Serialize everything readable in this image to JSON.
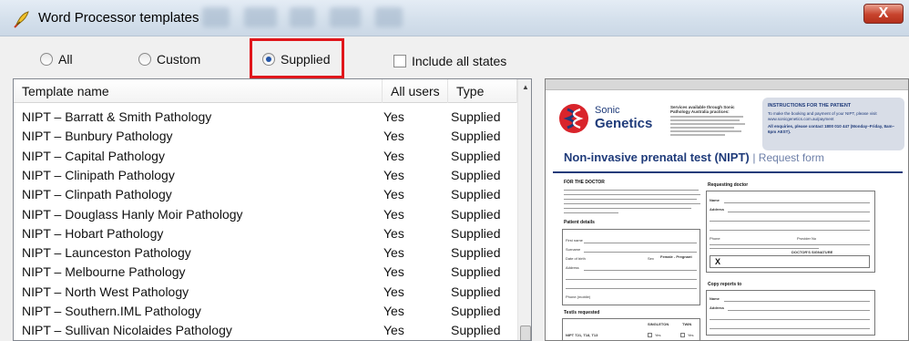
{
  "window": {
    "title": "Word Processor templates",
    "close_label": "X"
  },
  "filters": {
    "all_label": "All",
    "custom_label": "Custom",
    "supplied_label": "Supplied",
    "selected": "Supplied",
    "include_all_states_label": "Include all states",
    "include_all_states_checked": false
  },
  "table": {
    "columns": [
      "Template name",
      "All users",
      "Type"
    ],
    "rows": [
      {
        "name": "NIPT – Barratt & Smith Pathology",
        "all_users": "Yes",
        "type": "Supplied"
      },
      {
        "name": "NIPT – Bunbury Pathology",
        "all_users": "Yes",
        "type": "Supplied"
      },
      {
        "name": "NIPT – Capital Pathology",
        "all_users": "Yes",
        "type": "Supplied"
      },
      {
        "name": "NIPT – Clinipath Pathology",
        "all_users": "Yes",
        "type": "Supplied"
      },
      {
        "name": "NIPT – Clinpath Pathology",
        "all_users": "Yes",
        "type": "Supplied"
      },
      {
        "name": "NIPT – Douglass Hanly Moir Pathology",
        "all_users": "Yes",
        "type": "Supplied"
      },
      {
        "name": "NIPT – Hobart Pathology",
        "all_users": "Yes",
        "type": "Supplied"
      },
      {
        "name": "NIPT – Launceston Pathology",
        "all_users": "Yes",
        "type": "Supplied"
      },
      {
        "name": "NIPT – Melbourne Pathology",
        "all_users": "Yes",
        "type": "Supplied"
      },
      {
        "name": "NIPT – North West Pathology",
        "all_users": "Yes",
        "type": "Supplied"
      },
      {
        "name": "NIPT – Southern.IML Pathology",
        "all_users": "Yes",
        "type": "Supplied"
      },
      {
        "name": "NIPT – Sullivan Nicolaides Pathology",
        "all_users": "Yes",
        "type": "Supplied"
      }
    ]
  },
  "preview": {
    "brand_line1": "Sonic",
    "brand_line2": "Genetics",
    "services_heading": "Services available through Sonic Pathology Australia practices:",
    "instructions_heading": "INSTRUCTIONS FOR THE PATIENT",
    "instructions_text": "To make the booking and payment of your NIPT, please visit www.sonicgenetics.com.au/payment",
    "enquiries_text": "All enquiries, please contact 1800 010 447 (Monday–Friday, 8am–6pm AEST).",
    "doc_title": "Non-invasive prenatal test (NIPT)",
    "doc_subtitle": "| Request form",
    "for_doctor": "FOR THE DOCTOR",
    "requesting_doctor": "Requesting doctor",
    "patient_details": "Patient details",
    "copy_reports": "Copy reports to",
    "tests_requested": "Test/s requested",
    "first_name": "First name",
    "surname": "Surname",
    "dob": "Date of birth",
    "sex": "Sex",
    "sex_value": "Female - Pregnant",
    "address": "Address",
    "phone_mobile": "Phone (mobile)",
    "name": "Name",
    "phone": "Phone",
    "provider_no": "Provider No",
    "doctors_signature": "DOCTOR'S SIGNATURE",
    "signature_mark": "X",
    "singleton": "SINGLETON",
    "twin": "TWIN",
    "test_row": "NIPT T21, T18, T13",
    "yes_label": "Yes"
  }
}
